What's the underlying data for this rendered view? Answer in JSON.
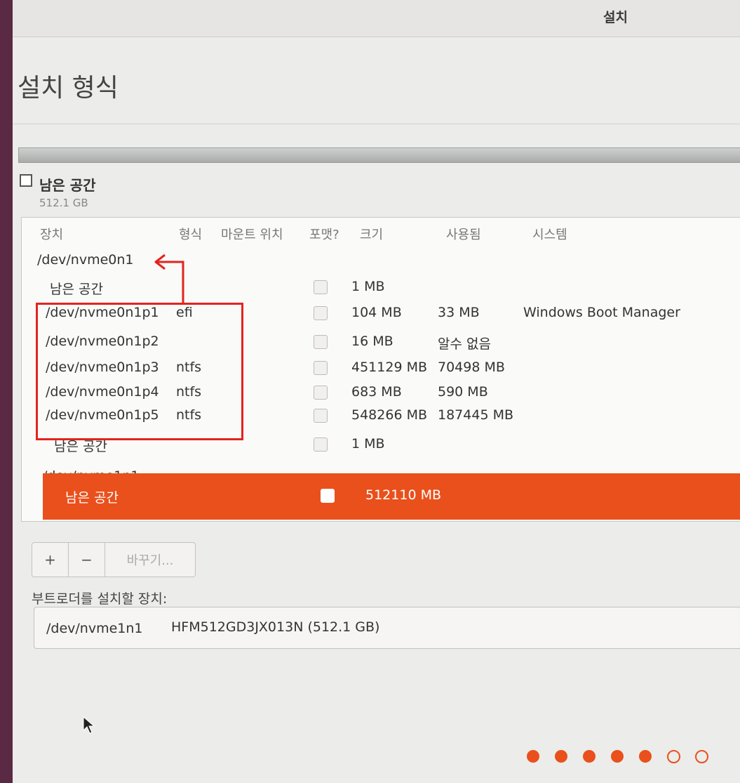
{
  "window": {
    "title": "설치"
  },
  "page": {
    "title": "설치 형식"
  },
  "legend": {
    "name": "남은 공간",
    "size": "512.1 GB"
  },
  "table": {
    "headers": {
      "device": "장치",
      "type": "형식",
      "mount": "마운트 위치",
      "format": "포맷?",
      "size": "크기",
      "used": "사용됨",
      "system": "시스템"
    },
    "rows": [
      {
        "device": "/dev/nvme0n1",
        "type": "",
        "size": "",
        "used": "",
        "system": "",
        "has_checkbox": false
      },
      {
        "device": "남은 공간",
        "type": "",
        "size": "1 MB",
        "used": "",
        "system": "",
        "has_checkbox": true
      },
      {
        "device": "/dev/nvme0n1p1",
        "type": "efi",
        "size": "104 MB",
        "used": "33 MB",
        "system": "Windows Boot Manager",
        "has_checkbox": true
      },
      {
        "device": "/dev/nvme0n1p2",
        "type": "",
        "size": "16 MB",
        "used": "알수 없음",
        "system": "",
        "has_checkbox": true
      },
      {
        "device": "/dev/nvme0n1p3",
        "type": "ntfs",
        "size": "451129 MB",
        "used": "70498 MB",
        "system": "",
        "has_checkbox": true
      },
      {
        "device": "/dev/nvme0n1p4",
        "type": "ntfs",
        "size": "683 MB",
        "used": "590 MB",
        "system": "",
        "has_checkbox": true
      },
      {
        "device": "/dev/nvme0n1p5",
        "type": "ntfs",
        "size": "548266 MB",
        "used": "187445 MB",
        "system": "",
        "has_checkbox": true
      },
      {
        "device": "남은 공간",
        "type": "",
        "size": "1 MB",
        "used": "",
        "system": "",
        "has_checkbox": true
      },
      {
        "device": "/dev/nvme1n1",
        "type": "",
        "size": "",
        "used": "",
        "system": "",
        "has_checkbox": false
      },
      {
        "device": "남은 공간",
        "type": "",
        "size": "512110 MB",
        "used": "",
        "system": "",
        "has_checkbox": true,
        "selected": true
      }
    ]
  },
  "buttons": {
    "add": "+",
    "remove": "−",
    "change": "바꾸기..."
  },
  "bootloader": {
    "label": "부트로더를 설치할 장치:",
    "device": "/dev/nvme1n1",
    "description": "HFM512GD3JX013N (512.1 GB)"
  },
  "progress": {
    "total_steps": 7,
    "completed_steps": 5
  },
  "colors": {
    "accent": "#e9501c",
    "annotation": "#e3241d"
  }
}
